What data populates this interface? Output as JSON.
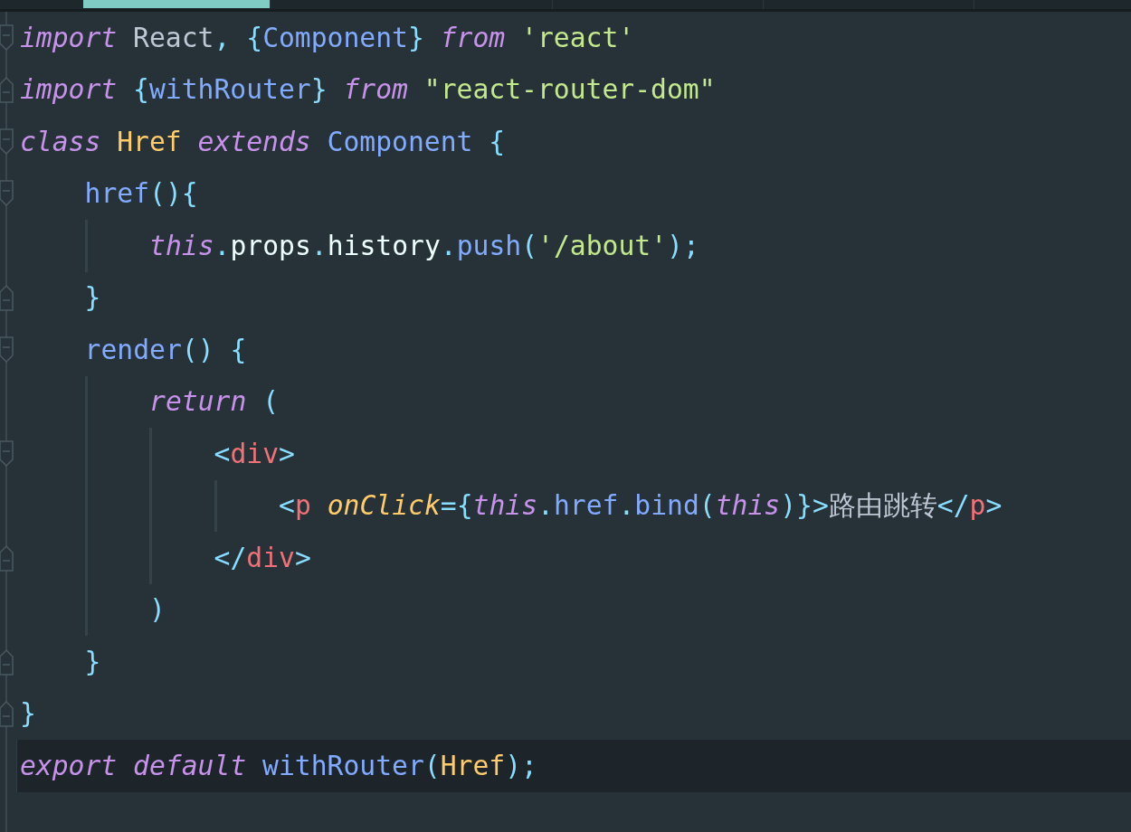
{
  "tabs": [
    {
      "selected": true
    },
    {
      "selected": false
    },
    {
      "selected": false
    },
    {
      "selected": false
    }
  ],
  "lines": [
    {
      "fold_start": true,
      "tokens": [
        {
          "kind": "keyword",
          "text": "import"
        },
        {
          "kind": "plain",
          "text": " React"
        },
        {
          "kind": "punct",
          "text": ","
        },
        {
          "kind": "punct",
          "text": " {"
        },
        {
          "kind": "func",
          "text": "Component"
        },
        {
          "kind": "punct",
          "text": "}"
        },
        {
          "kind": "keyword",
          "text": " from"
        },
        {
          "kind": "string",
          "text": " 'react'"
        }
      ]
    },
    {
      "fold_end": true,
      "tokens": [
        {
          "kind": "keyword",
          "text": "import"
        },
        {
          "kind": "punct",
          "text": " {"
        },
        {
          "kind": "func",
          "text": "withRouter"
        },
        {
          "kind": "punct",
          "text": "}"
        },
        {
          "kind": "keyword",
          "text": " from"
        },
        {
          "kind": "string",
          "text": " \"react-router-dom\""
        }
      ]
    },
    {
      "fold_start": true,
      "tokens": [
        {
          "kind": "keyword",
          "text": "class"
        },
        {
          "kind": "class",
          "text": " Href"
        },
        {
          "kind": "keyword",
          "text": " extends"
        },
        {
          "kind": "func",
          "text": " Component"
        },
        {
          "kind": "punct",
          "text": " {"
        }
      ],
      "children": [
        {
          "fold_start": true,
          "tokens": [
            {
              "kind": "func",
              "text": "href"
            },
            {
              "kind": "punct",
              "text": "(){"
            }
          ],
          "children": [
            {
              "tokens": [
                {
                  "kind": "keyword",
                  "text": "this"
                },
                {
                  "kind": "punct",
                  "text": "."
                },
                {
                  "kind": "variable",
                  "text": "props"
                },
                {
                  "kind": "punct",
                  "text": "."
                },
                {
                  "kind": "variable",
                  "text": "history"
                },
                {
                  "kind": "punct",
                  "text": "."
                },
                {
                  "kind": "func",
                  "text": "push"
                },
                {
                  "kind": "punct",
                  "text": "("
                },
                {
                  "kind": "string",
                  "text": "'/about'"
                },
                {
                  "kind": "punct",
                  "text": ");"
                }
              ]
            }
          ]
        },
        {
          "fold_end": true,
          "tokens": [
            {
              "kind": "punct",
              "text": "}"
            }
          ]
        },
        {
          "fold_start": true,
          "tokens": [
            {
              "kind": "func",
              "text": "render"
            },
            {
              "kind": "punct",
              "text": "() {"
            }
          ],
          "children": [
            {
              "tokens": [
                {
                  "kind": "keyword",
                  "text": "return"
                },
                {
                  "kind": "punct",
                  "text": " ("
                }
              ],
              "children": [
                {
                  "fold_start": true,
                  "tokens": [
                    {
                      "kind": "punct",
                      "text": "<"
                    },
                    {
                      "kind": "tag",
                      "text": "div"
                    },
                    {
                      "kind": "punct",
                      "text": ">"
                    }
                  ],
                  "children": [
                    {
                      "tokens": [
                        {
                          "kind": "punct",
                          "text": "<"
                        },
                        {
                          "kind": "tag",
                          "text": "p"
                        },
                        {
                          "kind": "attr",
                          "text": " onClick"
                        },
                        {
                          "kind": "punct",
                          "text": "={"
                        },
                        {
                          "kind": "keyword",
                          "text": "this"
                        },
                        {
                          "kind": "punct",
                          "text": "."
                        },
                        {
                          "kind": "func",
                          "text": "href"
                        },
                        {
                          "kind": "punct",
                          "text": "."
                        },
                        {
                          "kind": "func",
                          "text": "bind"
                        },
                        {
                          "kind": "punct",
                          "text": "("
                        },
                        {
                          "kind": "keyword",
                          "text": "this"
                        },
                        {
                          "kind": "punct",
                          "text": ")}>"
                        },
                        {
                          "kind": "plain",
                          "text": "路由跳转"
                        },
                        {
                          "kind": "punct",
                          "text": "</"
                        },
                        {
                          "kind": "tag",
                          "text": "p"
                        },
                        {
                          "kind": "punct",
                          "text": ">"
                        }
                      ]
                    }
                  ]
                },
                {
                  "fold_end": true,
                  "tokens": [
                    {
                      "kind": "punct",
                      "text": "</"
                    },
                    {
                      "kind": "tag",
                      "text": "div"
                    },
                    {
                      "kind": "punct",
                      "text": ">"
                    }
                  ]
                }
              ]
            },
            {
              "tokens": [
                {
                  "kind": "punct",
                  "text": ")"
                }
              ]
            }
          ]
        },
        {
          "fold_end": true,
          "tokens": [
            {
              "kind": "punct",
              "text": "}"
            }
          ]
        }
      ]
    },
    {
      "fold_end": true,
      "tokens": [
        {
          "kind": "punct",
          "text": "}"
        }
      ]
    },
    {
      "current": true,
      "tokens": [
        {
          "kind": "keyword",
          "text": "export"
        },
        {
          "kind": "keyword",
          "text": " default"
        },
        {
          "kind": "func",
          "text": " withRouter"
        },
        {
          "kind": "punct",
          "text": "("
        },
        {
          "kind": "class",
          "text": "Href"
        },
        {
          "kind": "punct",
          "text": ");"
        }
      ]
    }
  ]
}
